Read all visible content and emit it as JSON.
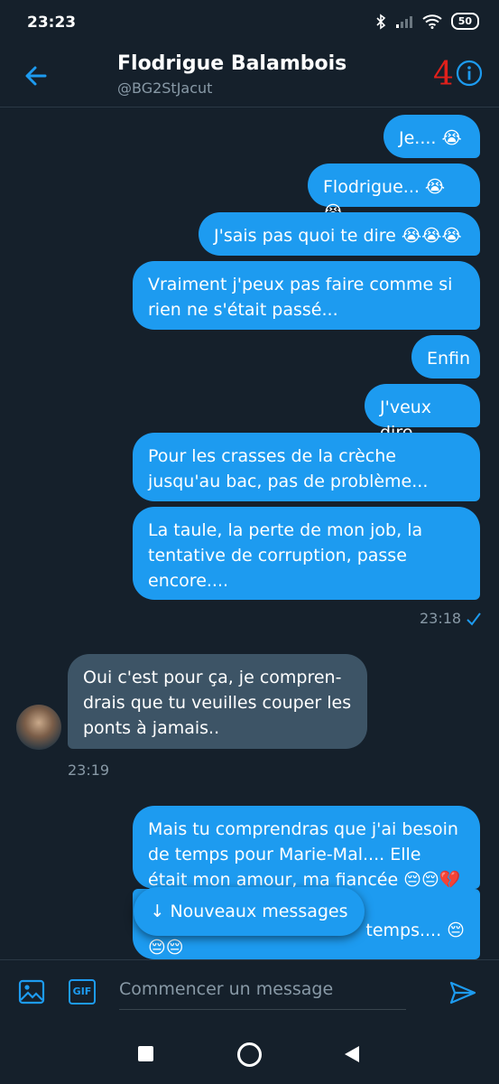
{
  "status_bar": {
    "time": "23:23",
    "battery": "50"
  },
  "header": {
    "name": "Flodrigue Balambois",
    "handle": "@BG2StJacut",
    "overlay_number": "4"
  },
  "messages": [
    {
      "dir": "out",
      "text": "Je.... 😭"
    },
    {
      "dir": "out",
      "text": "Flodrigue... 😭😭"
    },
    {
      "dir": "out",
      "text": "J'sais pas quoi te dire 😭😭😭"
    },
    {
      "dir": "out",
      "text": "Vraiment j'peux pas faire comme si rien ne s'était passé..."
    },
    {
      "dir": "out",
      "text": "Enfin"
    },
    {
      "dir": "out",
      "text": "J'veux dire"
    },
    {
      "dir": "out",
      "text": "Pour les crasses de la crèche jusqu'au bac, pas de problème..."
    },
    {
      "dir": "out",
      "text": "La taule, la perte de mon job, la tentative de corruption, passe encore...."
    },
    {
      "dir": "in",
      "text": "Oui c'est pour ça, je compren- drais que tu veuilles couper les ponts à jamais.."
    },
    {
      "dir": "out",
      "text": "Mais tu comprendras que j'ai besoin de temps pour Marie-Mal.... Elle était mon amour, ma fiancée 😔😔💔💔"
    },
    {
      "dir": "out",
      "text": "temps.... 😔"
    },
    {
      "dir": "out",
      "text": "😔😔"
    }
  ],
  "timestamps": {
    "sent": "23:18",
    "received": "23:19"
  },
  "new_messages_pill": "↓ Nouveaux messages",
  "composer": {
    "placeholder": "Commencer un message",
    "gif_label": "GIF"
  },
  "colors": {
    "background": "#15202b",
    "bubble_out": "#1d9bf0",
    "bubble_in": "#3d5466",
    "accent": "#1d9bf0"
  }
}
